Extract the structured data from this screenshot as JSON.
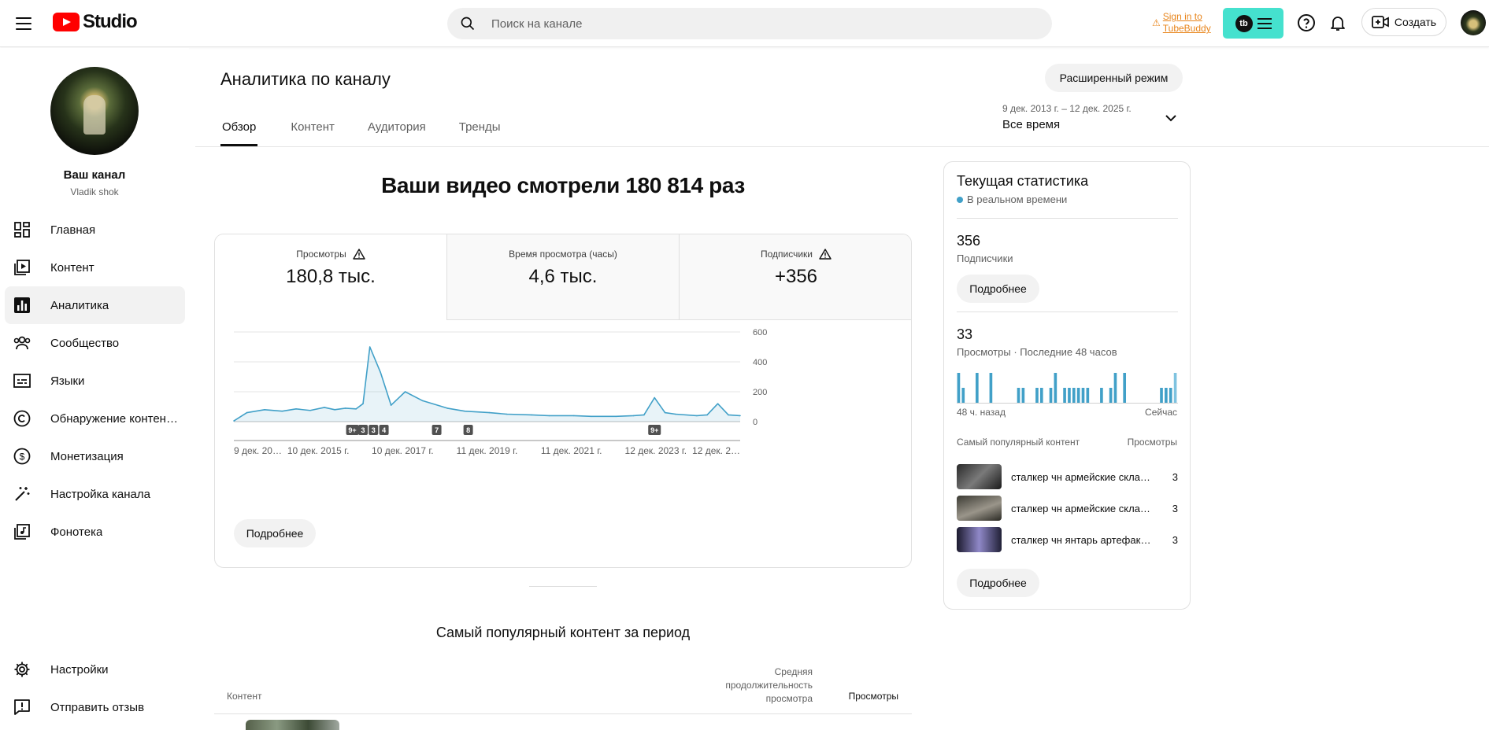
{
  "header": {
    "logo_text": "Studio",
    "search_placeholder": "Поиск на канале",
    "tubebuddy_line1": "Sign in to",
    "tubebuddy_line2": "TubeBuddy",
    "tubebuddy_badge": "tb",
    "create_label": "Создать",
    "accent_color": "#ff0000",
    "tubebuddy_color": "#45e1ce"
  },
  "sidebar": {
    "channel_title": "Ваш канал",
    "channel_name": "Vladik shok",
    "items": [
      {
        "label": "Главная",
        "icon": "dashboard-icon",
        "active": false
      },
      {
        "label": "Контент",
        "icon": "content-icon",
        "active": false
      },
      {
        "label": "Аналитика",
        "icon": "analytics-icon",
        "active": true
      },
      {
        "label": "Сообщество",
        "icon": "community-icon",
        "active": false
      },
      {
        "label": "Языки",
        "icon": "subtitles-icon",
        "active": false
      },
      {
        "label": "Обнаружение контен…",
        "icon": "copyright-icon",
        "active": false
      },
      {
        "label": "Монетизация",
        "icon": "dollar-icon",
        "active": false
      },
      {
        "label": "Настройка канала",
        "icon": "magic-wand-icon",
        "active": false
      },
      {
        "label": "Фонотека",
        "icon": "audio-library-icon",
        "active": false
      }
    ],
    "bottom_items": [
      {
        "label": "Настройки",
        "icon": "gear-icon"
      },
      {
        "label": "Отправить отзыв",
        "icon": "feedback-icon"
      }
    ]
  },
  "main": {
    "title": "Аналитика по каналу",
    "advanced_mode": "Расширенный режим",
    "tabs": [
      {
        "label": "Обзор",
        "active": true
      },
      {
        "label": "Контент",
        "active": false
      },
      {
        "label": "Аудитория",
        "active": false
      },
      {
        "label": "Тренды",
        "active": false
      }
    ],
    "date_range_sub": "9 дек. 2013 г. – 12 дек. 2025 г.",
    "date_range_main": "Все время",
    "headline": "Ваши видео смотрели 180 814 раз",
    "metrics": [
      {
        "label": "Просмотры",
        "value": "180,8 тыс.",
        "warning": true,
        "selected": true
      },
      {
        "label": "Время просмотра (часы)",
        "value": "4,6 тыс.",
        "warning": false,
        "selected": false
      },
      {
        "label": "Подписчики",
        "value": "+356",
        "warning": true,
        "selected": false
      }
    ],
    "more_button": "Подробнее",
    "popular_title": "Самый популярный контент за период",
    "table_headers": {
      "content": "Контент",
      "avg_duration": "Средняя продолжительность просмотра",
      "views": "Просмотры"
    }
  },
  "chart_data": {
    "type": "area",
    "series": [
      {
        "name": "Просмотры",
        "color": "#41a0c8"
      }
    ],
    "x_tick_labels": [
      "9 дек. 20…",
      "10 дек. 2015 г.",
      "10 дек. 2017 г.",
      "11 дек. 2019 г.",
      "11 дек. 2021 г.",
      "12 дек. 2023 г.",
      "12 дек. 2…"
    ],
    "x_ticks": [
      "2013-12-09",
      "2015-12-10",
      "2017-12-10",
      "2019-12-11",
      "2021-12-11",
      "2023-12-12",
      "2025-12-12"
    ],
    "y_ticks": [
      0,
      200,
      400,
      600
    ],
    "ylim": [
      0,
      600
    ],
    "x": [
      "2013-12-09",
      "2014-04-01",
      "2014-09-01",
      "2015-02-01",
      "2015-06-01",
      "2015-10-01",
      "2016-02-01",
      "2016-05-01",
      "2016-08-01",
      "2016-11-01",
      "2017-01-01",
      "2017-03-01",
      "2017-06-01",
      "2017-09-01",
      "2018-01-01",
      "2018-06-01",
      "2019-01-01",
      "2019-06-01",
      "2020-01-01",
      "2020-06-01",
      "2021-01-01",
      "2021-06-01",
      "2022-01-01",
      "2022-06-01",
      "2023-01-01",
      "2023-06-01",
      "2023-09-01",
      "2023-12-01",
      "2024-03-01",
      "2024-06-01",
      "2024-12-01",
      "2025-03-01",
      "2025-06-01",
      "2025-09-01",
      "2025-12-12"
    ],
    "values": [
      5,
      60,
      80,
      70,
      85,
      75,
      95,
      80,
      90,
      85,
      120,
      500,
      330,
      110,
      200,
      140,
      90,
      70,
      60,
      50,
      45,
      40,
      40,
      35,
      35,
      40,
      45,
      160,
      60,
      50,
      40,
      45,
      120,
      45,
      40
    ],
    "annotations": [
      {
        "label": "9+",
        "x": "2016-10-01"
      },
      {
        "label": "3",
        "x": "2017-01-01"
      },
      {
        "label": "3",
        "x": "2017-04-01"
      },
      {
        "label": "4",
        "x": "2017-07-01"
      },
      {
        "label": "7",
        "x": "2018-10-01"
      },
      {
        "label": "8",
        "x": "2019-07-01"
      },
      {
        "label": "9+",
        "x": "2023-12-01"
      }
    ]
  },
  "realtime": {
    "title": "Текущая статистика",
    "live_label": "В реальном времени",
    "subscribers_value": "356",
    "subscribers_label": "Подписчики",
    "views_value": "33",
    "views_label": "Просмотры · Последние 48 часов",
    "hourly_views": [
      2,
      1,
      0,
      0,
      2,
      0,
      0,
      2,
      0,
      0,
      0,
      0,
      0,
      1,
      1,
      0,
      0,
      1,
      1,
      0,
      1,
      2,
      0,
      1,
      1,
      1,
      1,
      1,
      1,
      0,
      0,
      1,
      0,
      1,
      2,
      0,
      2,
      0,
      0,
      0,
      0,
      0,
      0,
      0,
      1,
      1,
      1,
      2
    ],
    "axis_left": "48 ч. назад",
    "axis_right": "Сейчас",
    "popular_label": "Самый популярный контент",
    "popular_views_label": "Просмотры",
    "more_button": "Подробнее",
    "top_videos": [
      {
        "title": "сталкер чн армейские скла…",
        "views": "3"
      },
      {
        "title": "сталкер чн армейские скла…",
        "views": "3"
      },
      {
        "title": "сталкер чн янтарь артефакт…",
        "views": "3"
      }
    ]
  }
}
